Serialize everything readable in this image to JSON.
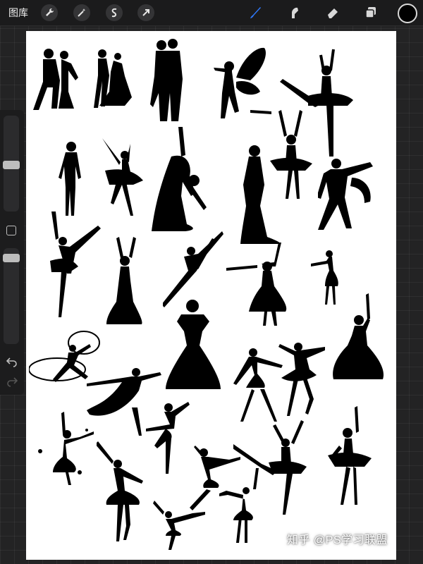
{
  "toolbar": {
    "gallery_label": "图库",
    "actions": [
      {
        "name": "wrench-icon"
      },
      {
        "name": "magic-wand-icon"
      },
      {
        "name": "selection-icon"
      },
      {
        "name": "transform-arrow-icon"
      }
    ],
    "tools": [
      {
        "name": "brush-icon",
        "color": "#2f7bff"
      },
      {
        "name": "smudge-icon",
        "color": "#d8d8d8"
      },
      {
        "name": "eraser-icon",
        "color": "#d8d8d8"
      },
      {
        "name": "layers-icon",
        "color": "#d8d8d8"
      }
    ],
    "current_color": "#000000"
  },
  "sidebar": {
    "brush_size_icon": "slider-handle",
    "opacity_icon": "slider-handle",
    "modify_icon": "square-icon",
    "undo_icon": "undo-arrow-icon",
    "redo_icon": "redo-arrow-icon"
  },
  "canvas": {
    "background": "#ffffff",
    "silhouette_color": "#000000"
  },
  "watermark": "知乎 @PS学习联盟"
}
